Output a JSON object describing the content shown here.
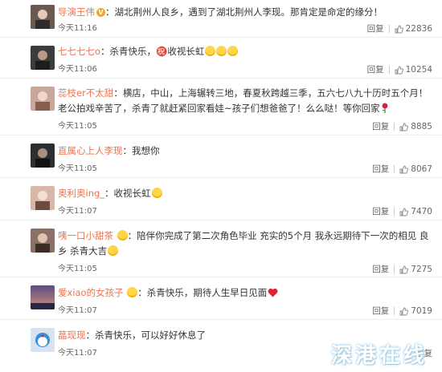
{
  "comments": [
    {
      "user": "导演王伟",
      "verified": true,
      "sep": "：",
      "text": "湖北荆州人良乡，遇到了湖北荆州人李现。那肯定是命定的缘分！",
      "emojis": [],
      "time": "今天11:16",
      "reply": "回复",
      "likes": "22836",
      "avatar_color": "#6b5a52"
    },
    {
      "user": "七七七七o",
      "verified": false,
      "sep": "：",
      "text": "杀青快乐，㊗️收视长虹",
      "emojis": [
        "gold-star-face-emoji",
        "gold-star-face-emoji",
        "gold-star-face-emoji"
      ],
      "time": "今天11:06",
      "reply": "回复",
      "likes": "10254",
      "avatar_color": "#3c3c3c"
    },
    {
      "user": "蕊枝er不太甜",
      "verified": false,
      "sep": "：",
      "text": "横店，中山，上海辗转三地，春夏秋跨越三季，五六七八九十历时五个月！老公拍戏辛苦了，杀青了就赶紧回家看娃~孩子们想爸爸了！么么哒！等你回家",
      "emojis": [
        "rose-emoji"
      ],
      "time": "今天11:05",
      "reply": "回复",
      "likes": "8885",
      "avatar_color": "#c9a89b"
    },
    {
      "user": "直属心上人李现",
      "verified": false,
      "sep": "：",
      "text": "我想你",
      "emojis": [],
      "time": "今天11:05",
      "reply": "回复",
      "likes": "8067",
      "avatar_color": "#2e2e2e"
    },
    {
      "user": "奥利奥ing_",
      "verified": false,
      "sep": "：",
      "text": "收视长虹",
      "emojis": [
        "gold-star-face-emoji"
      ],
      "time": "今天11:07",
      "reply": "回复",
      "likes": "7470",
      "avatar_color": "#d9b7a8"
    },
    {
      "user": "咦一口小甜茶",
      "verified": false,
      "sep": "：",
      "text": "陪伴你完成了第二次角色毕业 充实的5个月 我永远期待下一次的相见 良乡 杀青大吉",
      "emojis_after_user": [
        "face-emoji"
      ],
      "emojis": [
        "smile-emoji"
      ],
      "time": "今天11:05",
      "reply": "回复",
      "likes": "7275",
      "avatar_color": "#8a7066"
    },
    {
      "user": "爱xiao的女孩子",
      "verified": false,
      "sep": "：",
      "text": "杀青快乐，期待人生早日见面",
      "emojis_after_user": [
        "face-emoji"
      ],
      "emojis": [
        "heart-emoji"
      ],
      "time": "今天11:07",
      "reply": "回复",
      "likes": "7019",
      "avatar_color": "#4e3f6b"
    },
    {
      "user": "蕌现现",
      "verified": false,
      "sep": "：",
      "text": "杀青快乐，可以好好休息了",
      "emojis": [],
      "time": "今天11:07",
      "reply": "回复",
      "likes": "",
      "avatar_color": "#d7e3ee"
    }
  ],
  "watermark": "深港在线",
  "colors": {
    "username": "#eb7350",
    "meta": "#666666",
    "divider": "#eeeeee"
  }
}
